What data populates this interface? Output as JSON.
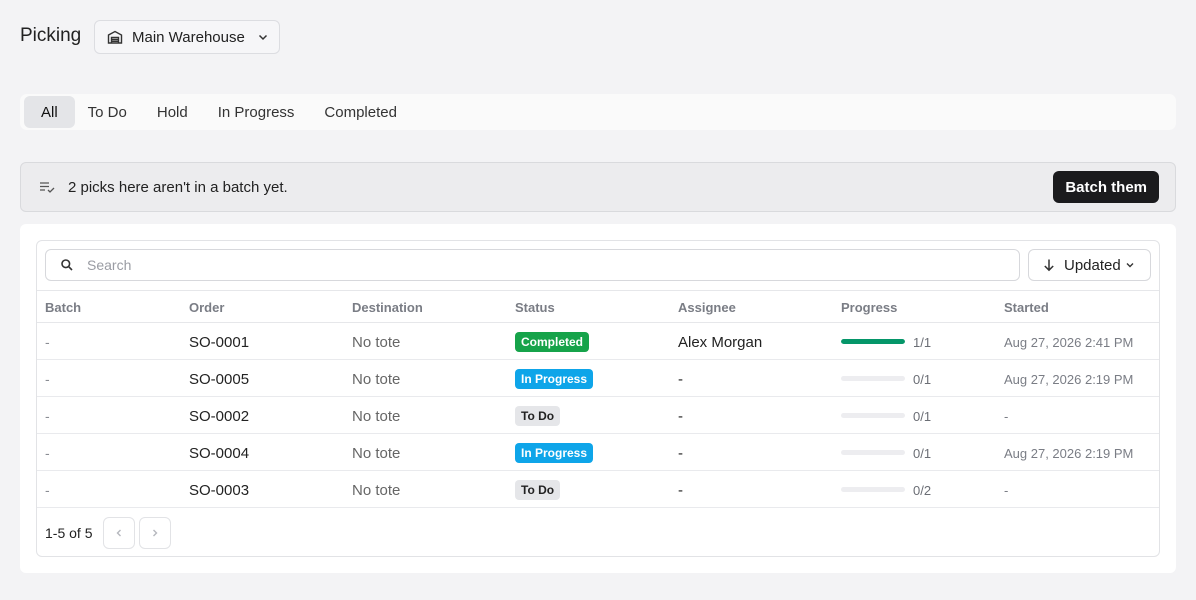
{
  "header": {
    "title": "Picking",
    "warehouse": "Main Warehouse",
    "warehouse_icon": "warehouse-icon"
  },
  "tabs": [
    {
      "label": "All",
      "active": true
    },
    {
      "label": "To Do",
      "active": false
    },
    {
      "label": "Hold",
      "active": false
    },
    {
      "label": "In Progress",
      "active": false
    },
    {
      "label": "Completed",
      "active": false
    }
  ],
  "banner": {
    "message": "2 picks here aren't in a batch yet.",
    "button": "Batch them"
  },
  "search": {
    "placeholder": "Search",
    "value": ""
  },
  "sort": {
    "label": "Updated"
  },
  "columns": [
    "Batch",
    "Order",
    "Destination",
    "Status",
    "Assignee",
    "Progress",
    "Started"
  ],
  "rows": [
    {
      "batch": "-",
      "order": "SO-0001",
      "destination": "No tote",
      "status": "Completed",
      "status_kind": "completed",
      "assignee": "Alex Morgan",
      "progress_done": 1,
      "progress_total": 1,
      "progress_label": "1/1",
      "started": "Aug 27, 2026 2:41 PM"
    },
    {
      "batch": "-",
      "order": "SO-0005",
      "destination": "No tote",
      "status": "In Progress",
      "status_kind": "inprogress",
      "assignee": "-",
      "progress_done": 0,
      "progress_total": 1,
      "progress_label": "0/1",
      "started": "Aug 27, 2026 2:19 PM"
    },
    {
      "batch": "-",
      "order": "SO-0002",
      "destination": "No tote",
      "status": "To Do",
      "status_kind": "todo",
      "assignee": "-",
      "progress_done": 0,
      "progress_total": 1,
      "progress_label": "0/1",
      "started": "-"
    },
    {
      "batch": "-",
      "order": "SO-0004",
      "destination": "No tote",
      "status": "In Progress",
      "status_kind": "inprogress",
      "assignee": "-",
      "progress_done": 0,
      "progress_total": 1,
      "progress_label": "0/1",
      "started": "Aug 27, 2026 2:19 PM"
    },
    {
      "batch": "-",
      "order": "SO-0003",
      "destination": "No tote",
      "status": "To Do",
      "status_kind": "todo",
      "assignee": "-",
      "progress_done": 0,
      "progress_total": 2,
      "progress_label": "0/2",
      "started": "-"
    }
  ],
  "pagination": {
    "summary": "1-5 of 5"
  },
  "colors": {
    "completed": "#16a34a",
    "in_progress": "#0ea5e9",
    "todo": "#e5e6e9",
    "progress_fill": "#059669",
    "primary_button": "#1b1b1d"
  }
}
